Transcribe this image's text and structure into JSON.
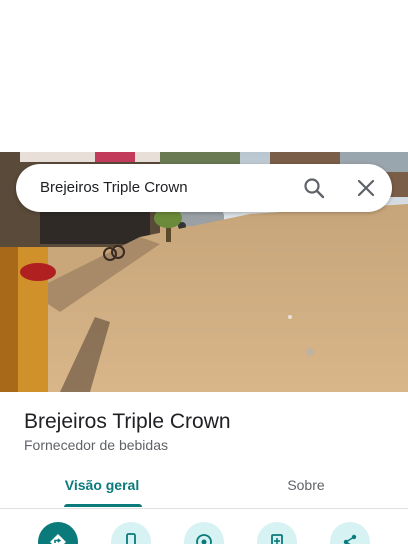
{
  "search": {
    "query": "Brejeiros Triple Crown"
  },
  "icons": {
    "search": "search-icon",
    "close": "close-icon",
    "directions": "directions-icon",
    "phone": "phone-icon",
    "location": "location-icon",
    "save": "save-icon",
    "share": "share-icon"
  },
  "place": {
    "title": "Brejeiros Triple Crown",
    "category": "Fornecedor de bebidas"
  },
  "tabs": [
    {
      "label": "Visão geral",
      "active": true
    },
    {
      "label": "Sobre",
      "active": false
    }
  ],
  "colors": {
    "accent": "#0b7a7a",
    "action_bg": "#d6f2f3",
    "text_primary": "#202124",
    "text_secondary": "#5f6368"
  }
}
